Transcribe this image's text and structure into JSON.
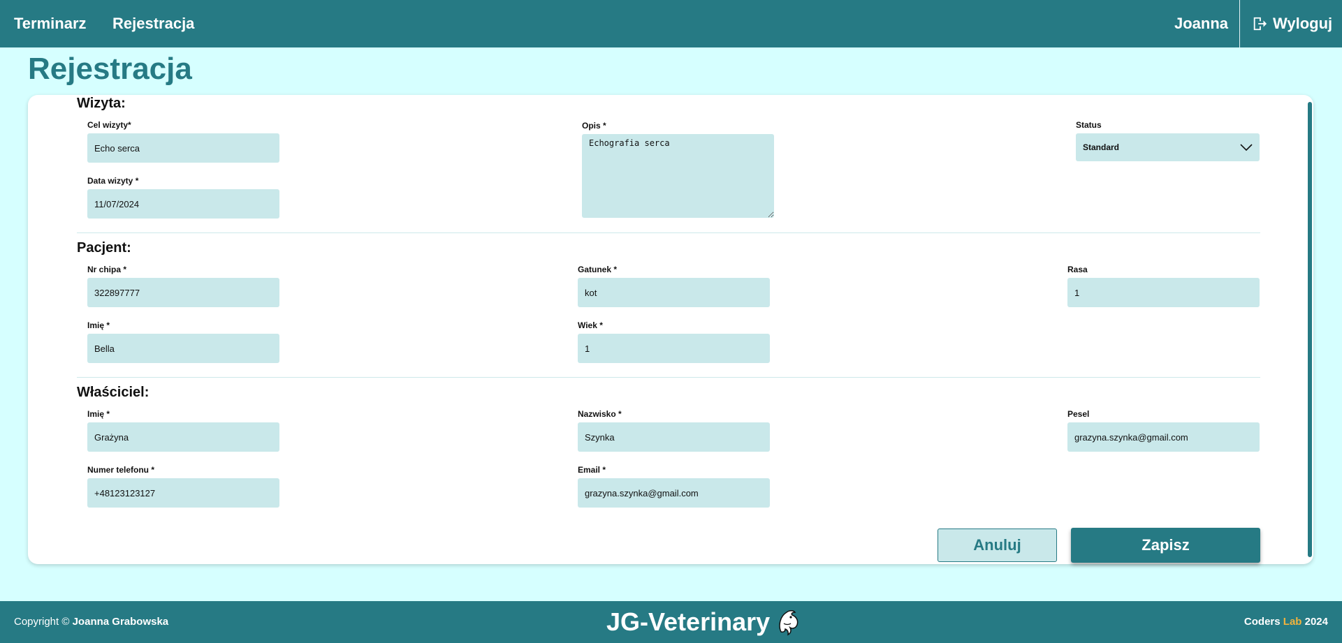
{
  "nav": {
    "items": [
      "Terminarz",
      "Rejestracja"
    ],
    "user": "Joanna",
    "logout": "Wyloguj"
  },
  "page": {
    "title": "Rejestracja"
  },
  "sections": {
    "visit": {
      "title": "Wizyta:",
      "purpose_label": "Cel wizyty*",
      "purpose_value": "Echo serca",
      "date_label": "Data wizyty *",
      "date_value": "11/07/2024",
      "description_label": "Opis *",
      "description_value": "Echografia serca",
      "status_label": "Status",
      "status_value": "Standard"
    },
    "patient": {
      "title": "Pacjent:",
      "chip_label": "Nr chipa *",
      "chip_value": "322897777",
      "species_label": "Gatunek *",
      "species_value": "kot",
      "breed_label": "Rasa",
      "breed_value": "1",
      "name_label": "Imię *",
      "name_value": "Bella",
      "age_label": "Wiek *",
      "age_value": "1"
    },
    "owner": {
      "title": "Właściciel:",
      "first_name_label": "Imię *",
      "first_name_value": "Grażyna",
      "last_name_label": "Nazwisko *",
      "last_name_value": "Szynka",
      "pesel_label": "Pesel",
      "pesel_value": "grazyna.szynka@gmail.com",
      "phone_label": "Numer telefonu *",
      "phone_value": "+48123123127",
      "email_label": "Email *",
      "email_value": "grazyna.szynka@gmail.com"
    }
  },
  "buttons": {
    "cancel": "Anuluj",
    "save": "Zapisz"
  },
  "footer": {
    "copyright_prefix": "Copyright ©",
    "copyright_name": "Joanna Grabowska",
    "brand": "JG-Veterinary",
    "brand_icon": "dolphin-icon",
    "credits_prefix": "Coders",
    "credits_accent": "Lab",
    "credits_year": "2024"
  },
  "colors": {
    "primary": "#267a84",
    "background": "#d6ffff",
    "input": "#c9e8ea",
    "accent": "#f2b33d"
  }
}
